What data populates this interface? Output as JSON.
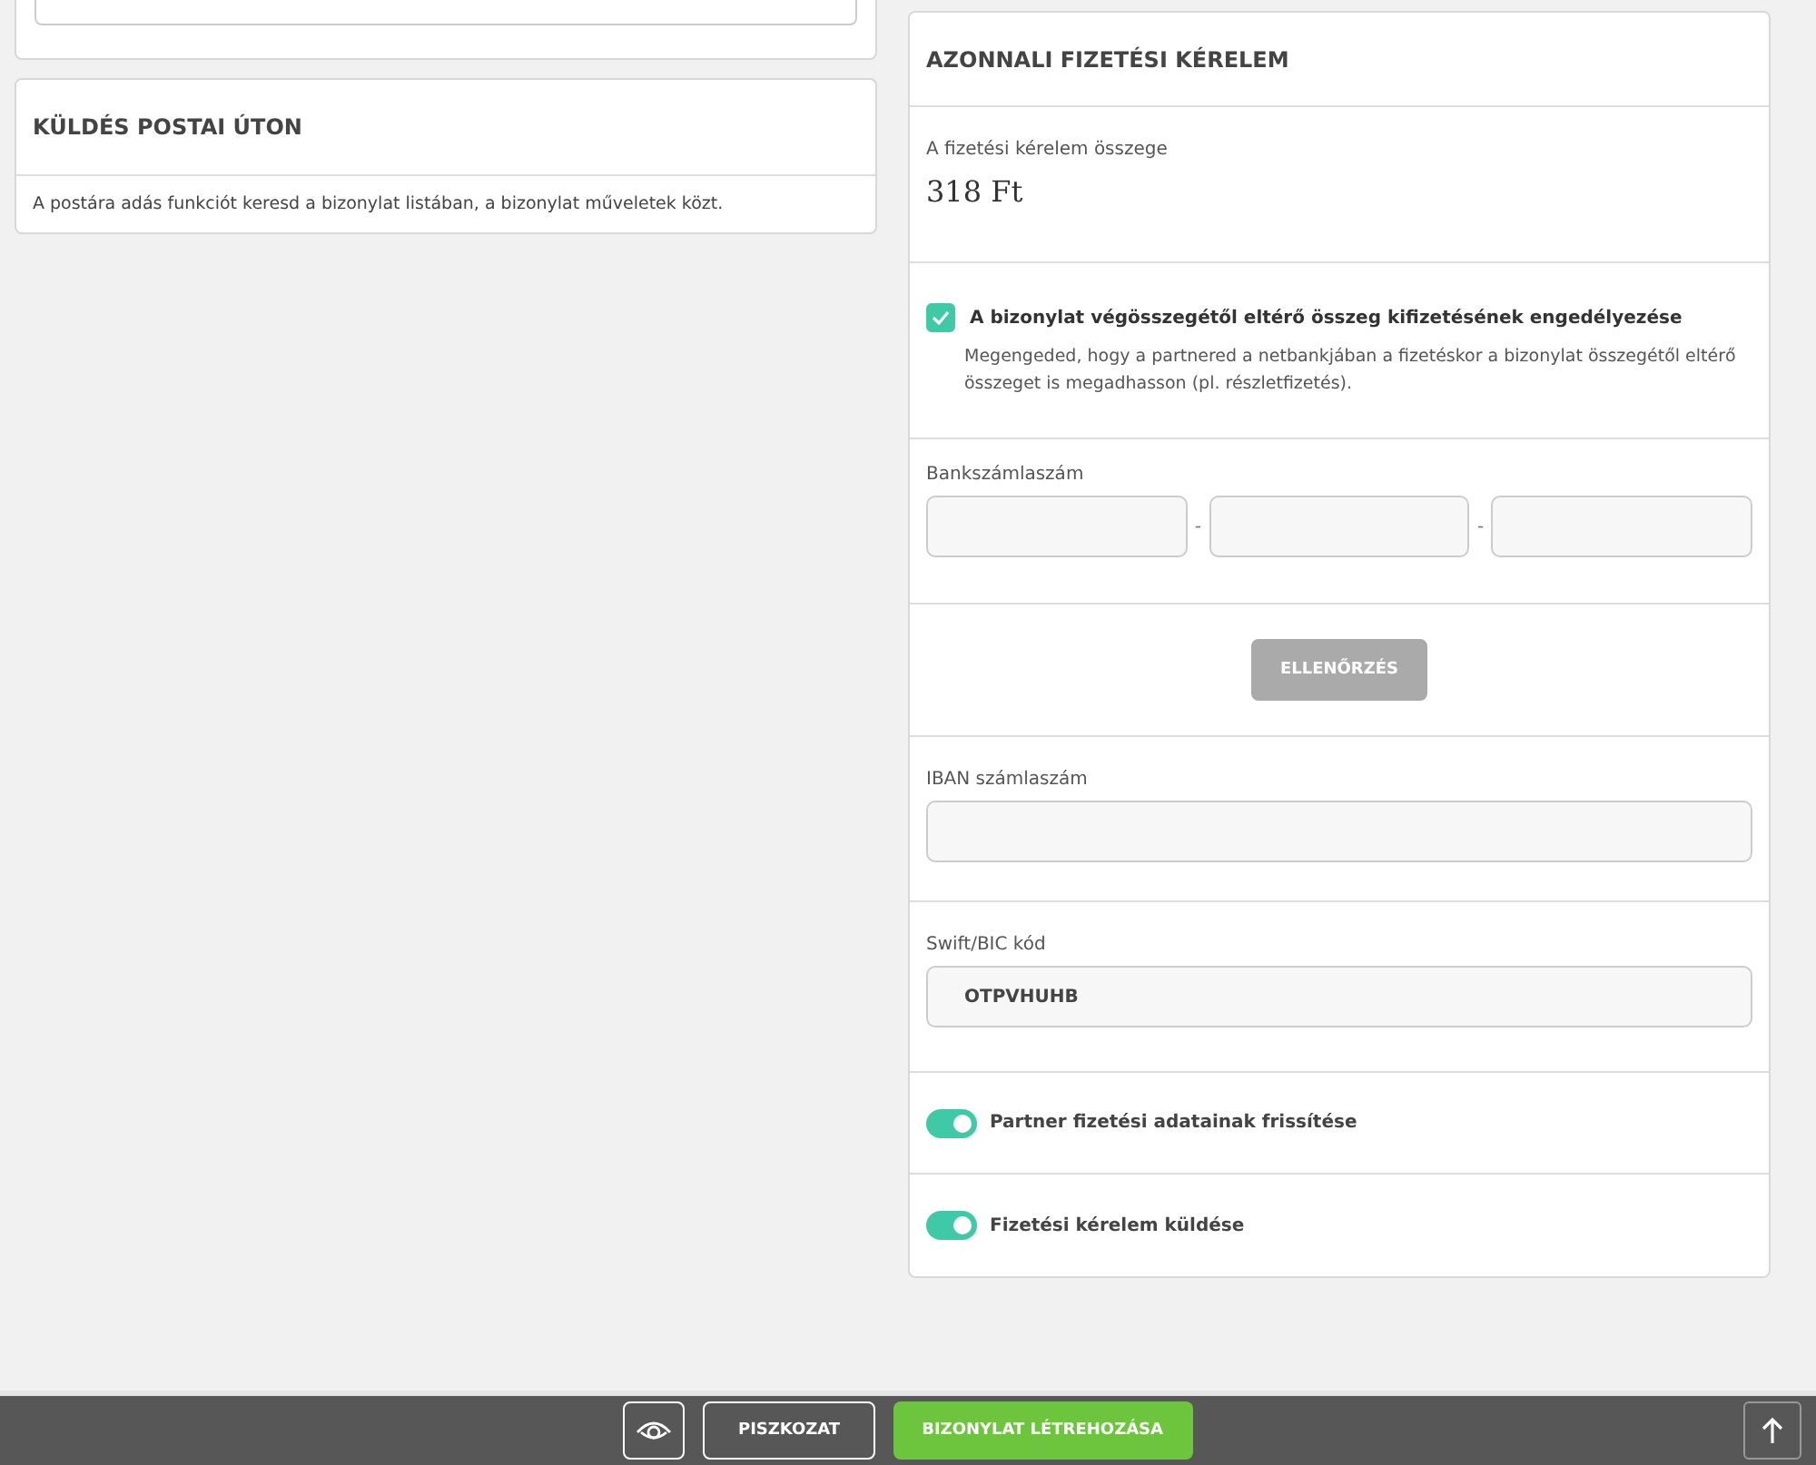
{
  "postal_card": {
    "title": "KÜLDÉS POSTAI ÚTON",
    "text": "A postára adás funkciót keresd a bizonylat listában, a bizonylat műveletek közt."
  },
  "payment_request": {
    "title": "AZONNALI FIZETÉSI KÉRELEM",
    "amount": {
      "label": "A fizetési kérelem összege",
      "value": "318 Ft"
    },
    "allow_different": {
      "label": "A bizonylat végösszegétől eltérő összeg kifizetésének engedélyezése",
      "checked": true,
      "description": "Megengeded, hogy a partnered a netbankjában a fizetéskor a bizonylat összegétől eltérő összeget is megadhasson (pl. részletfizetés)."
    },
    "bank_account": {
      "label": "Bankszámlaszám",
      "separators": [
        "-",
        "-"
      ]
    },
    "check_button": {
      "label": "ELLENŐRZÉS",
      "disabled": true
    },
    "iban": {
      "label": "IBAN számlaszám"
    },
    "swift": {
      "label": "Swift/BIC kód",
      "value": "OTPVHUHB"
    },
    "toggles": [
      {
        "label": "Partner fizetési adatainak frissítése",
        "on": true
      },
      {
        "label": "Fizetési kérelem küldése",
        "on": true
      }
    ]
  },
  "bottom_bar": {
    "draft_button": "PISZKOZAT",
    "create_button": "BIZONYLAT LÉTREHOZÁSA"
  }
}
